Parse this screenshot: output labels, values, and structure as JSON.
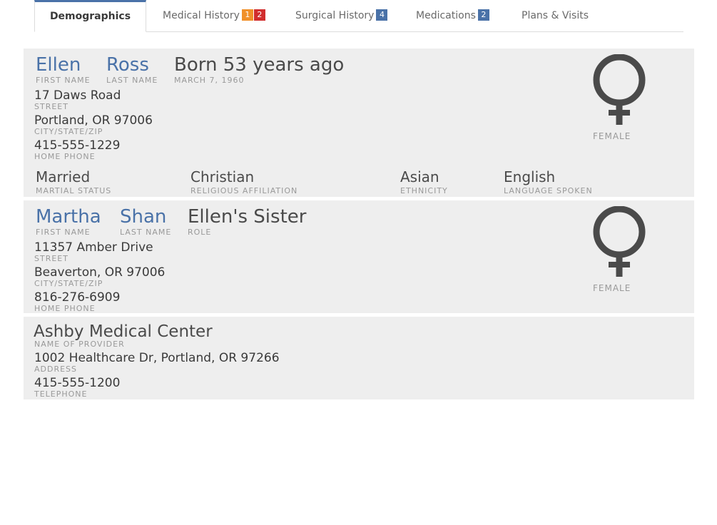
{
  "tabs": [
    {
      "label": "Demographics",
      "badges": []
    },
    {
      "label": "Medical History",
      "badges": [
        "1",
        "2"
      ]
    },
    {
      "label": "Surgical History",
      "badges": [
        "4"
      ]
    },
    {
      "label": "Medications",
      "badges": [
        "2"
      ]
    },
    {
      "label": "Plans & Visits",
      "badges": []
    }
  ],
  "patient": {
    "first_name": "Ellen",
    "first_name_label": "FIRST NAME",
    "last_name": "Ross",
    "last_name_label": "LAST NAME",
    "born": "Born 53 years ago",
    "dob": "MARCH 7, 1960",
    "street": "17 Daws Road",
    "street_label": "STREET",
    "city": "Portland, OR 97006",
    "city_label": "CITY/STATE/ZIP",
    "phone": "415-555-1229",
    "phone_label": "HOME PHONE",
    "gender": "FEMALE",
    "marital": "Married",
    "marital_label": "MARTIAL STATUS",
    "religion": "Christian",
    "religion_label": "RELIGIOUS AFFILIATION",
    "ethnicity": "Asian",
    "ethnicity_label": "ETHNICITY",
    "language": "English",
    "language_label": "LANGUAGE SPOKEN"
  },
  "contact": {
    "first_name": "Martha",
    "first_name_label": "FIRST NAME",
    "last_name": "Shan",
    "last_name_label": "LAST NAME",
    "role": "Ellen's Sister",
    "role_label": "ROLE",
    "street": "11357 Amber Drive",
    "street_label": "STREET",
    "city": "Beaverton, OR 97006",
    "city_label": "CITY/STATE/ZIP",
    "phone": "816-276-6909",
    "phone_label": "HOME PHONE",
    "gender": "FEMALE"
  },
  "provider": {
    "name": "Ashby Medical Center",
    "name_label": "NAME OF PROVIDER",
    "address": "1002 Healthcare Dr, Portland, OR 97266",
    "address_label": "ADDRESS",
    "phone": "415-555-1200",
    "phone_label": "TELEPHONE"
  },
  "colors": {
    "accent": "#4a72a8",
    "badge_orange": "#f0902a",
    "badge_red": "#d12e2e",
    "panel_bg": "#eeeeee"
  },
  "icons": {
    "gender": "female-symbol-icon"
  }
}
